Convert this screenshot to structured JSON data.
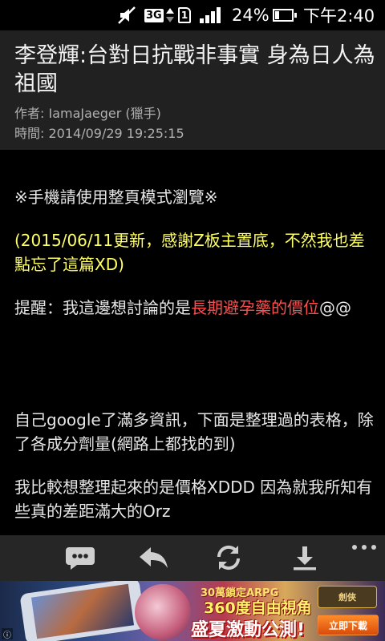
{
  "status_bar": {
    "network_type": "3G",
    "sim_slot": "1",
    "battery_percent": "24%",
    "battery_level": 0.24,
    "clock": "下午2:40",
    "icons": [
      "mute-icon",
      "data-arrows-icon",
      "sim-icon",
      "signal-icon",
      "battery-icon"
    ]
  },
  "article": {
    "title": "李登輝:台對日抗戰非事實 身為日人為祖國",
    "author": "作者: IamaJaeger (獵手)",
    "time": "時間: 2014/09/29 19:25:15",
    "body": {
      "notice": "※手機請使用整頁模式瀏覽※",
      "update": "(2015/06/11更新，感謝Z板主置底，不然我也差點忘了這篇XD)",
      "remind_prefix": "提醒：我這邊想討論的是",
      "remind_highlight": "長期避孕藥的價位",
      "remind_suffix": "@@",
      "google": "自己google了滿多資訊，下面是整理過的表格，除了各成分劑量(網路上都找的到)",
      "compare": "我比較想整理起來的是價格XDDD 因為就我所知有些真的差距滿大的Orz"
    },
    "colors": {
      "update_text": "#ffff66",
      "highlight_text": "#ff4d4d",
      "header_bg": "#212121",
      "toolbar_bg": "#262626"
    }
  },
  "toolbar": {
    "buttons": [
      {
        "name": "comment",
        "icon": "comment-icon"
      },
      {
        "name": "reply",
        "icon": "reply-icon"
      },
      {
        "name": "refresh",
        "icon": "refresh-icon"
      },
      {
        "name": "download",
        "icon": "download-icon"
      },
      {
        "name": "more",
        "icon": "more-icon"
      }
    ]
  },
  "ad": {
    "line1": "30萬鎖定ARPG",
    "line2": "360度自由視角",
    "line3": "盛夏激動公測!",
    "cta": "立即下載",
    "logo": "劍俠"
  }
}
